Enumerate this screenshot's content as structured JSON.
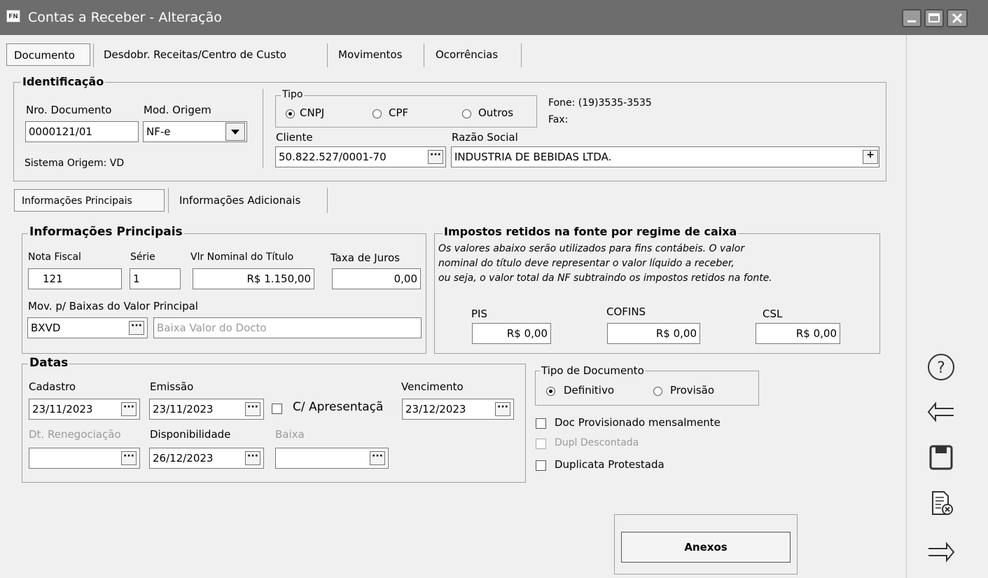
{
  "window": {
    "title": "Contas a Receber - Alteração",
    "app_icon": "FN"
  },
  "tabs": [
    "Documento",
    "Desdobr. Receitas/Centro de Custo",
    "Movimentos",
    "Ocorrências"
  ],
  "identificacao": {
    "legend": "Identificação",
    "nro_documento_label": "Nro. Documento",
    "nro_documento_value": "0000121/01",
    "mod_origem_label": "Mod. Origem",
    "mod_origem_value": "NF-e",
    "sistema_origem": "Sistema Origem: VD",
    "tipo_legend": "Tipo",
    "tipo_options": [
      "CNPJ",
      "CPF",
      "Outros"
    ],
    "tipo_selected": "CNPJ",
    "fone": "Fone: (19)3535-3535",
    "fax": "Fax:",
    "cliente_label": "Cliente",
    "cliente_value": "50.822.527/0001-70",
    "razao_social_label": "Razão Social",
    "razao_social_value": "INDUSTRIA DE BEBIDAS LTDA."
  },
  "subtabs": [
    "Informações Principais",
    "Informações Adicionais"
  ],
  "info_principais": {
    "legend": "Informações Principais",
    "nota_fiscal_label": "Nota Fiscal",
    "nota_fiscal_value": "121",
    "serie_label": "Série",
    "serie_value": "1",
    "vlr_nominal_label": "Vlr Nominal do Título",
    "vlr_nominal_value": "R$ 1.150,00",
    "taxa_juros_label": "Taxa de Juros",
    "taxa_juros_value": "0,00",
    "mov_label": "Mov. p/ Baixas do Valor Principal",
    "mov_code": "BXVD",
    "mov_desc": "Baixa Valor do Docto"
  },
  "impostos": {
    "legend": "Impostos retidos na fonte por regime de caixa",
    "note_lines": [
      "Os valores abaixo serão utilizados para fins contábeis. O valor",
      "nominal do título deve representar o valor líquido a receber,",
      "ou seja, o valor total da NF subtraindo os impostos retidos na fonte."
    ],
    "pis_label": "PIS",
    "pis_value": "R$ 0,00",
    "cofins_label": "COFINS",
    "cofins_value": "R$ 0,00",
    "csl_label": "CSL",
    "csl_value": "R$ 0,00"
  },
  "datas": {
    "legend": "Datas",
    "cadastro_label": "Cadastro",
    "cadastro_value": "23/11/2023",
    "emissao_label": "Emissão",
    "emissao_value": "23/11/2023",
    "apresentacao_label": "C/ Apresentaçã",
    "vencimento_label": "Vencimento",
    "vencimento_value": "23/12/2023",
    "renegociacao_label": "Dt. Renegociação",
    "renegociacao_value": "",
    "disponibilidade_label": "Disponibilidade",
    "disponibilidade_value": "26/12/2023",
    "baixa_label": "Baixa",
    "baixa_value": ""
  },
  "tipo_documento": {
    "legend": "Tipo de Documento",
    "options": [
      "Definitivo",
      "Provisão"
    ],
    "selected": "Definitivo"
  },
  "checks": {
    "doc_provisionado": "Doc Provisionado mensalmente",
    "dupl_descontada": "Dupl Descontada",
    "duplicata_protestada": "Duplicata Protestada"
  },
  "buttons": {
    "anexos": "Anexos",
    "dots": "···",
    "plus": "+"
  },
  "side_icons": [
    "help-icon",
    "back-arrow-icon",
    "save-icon",
    "cancel-document-icon",
    "forward-arrow-icon"
  ]
}
